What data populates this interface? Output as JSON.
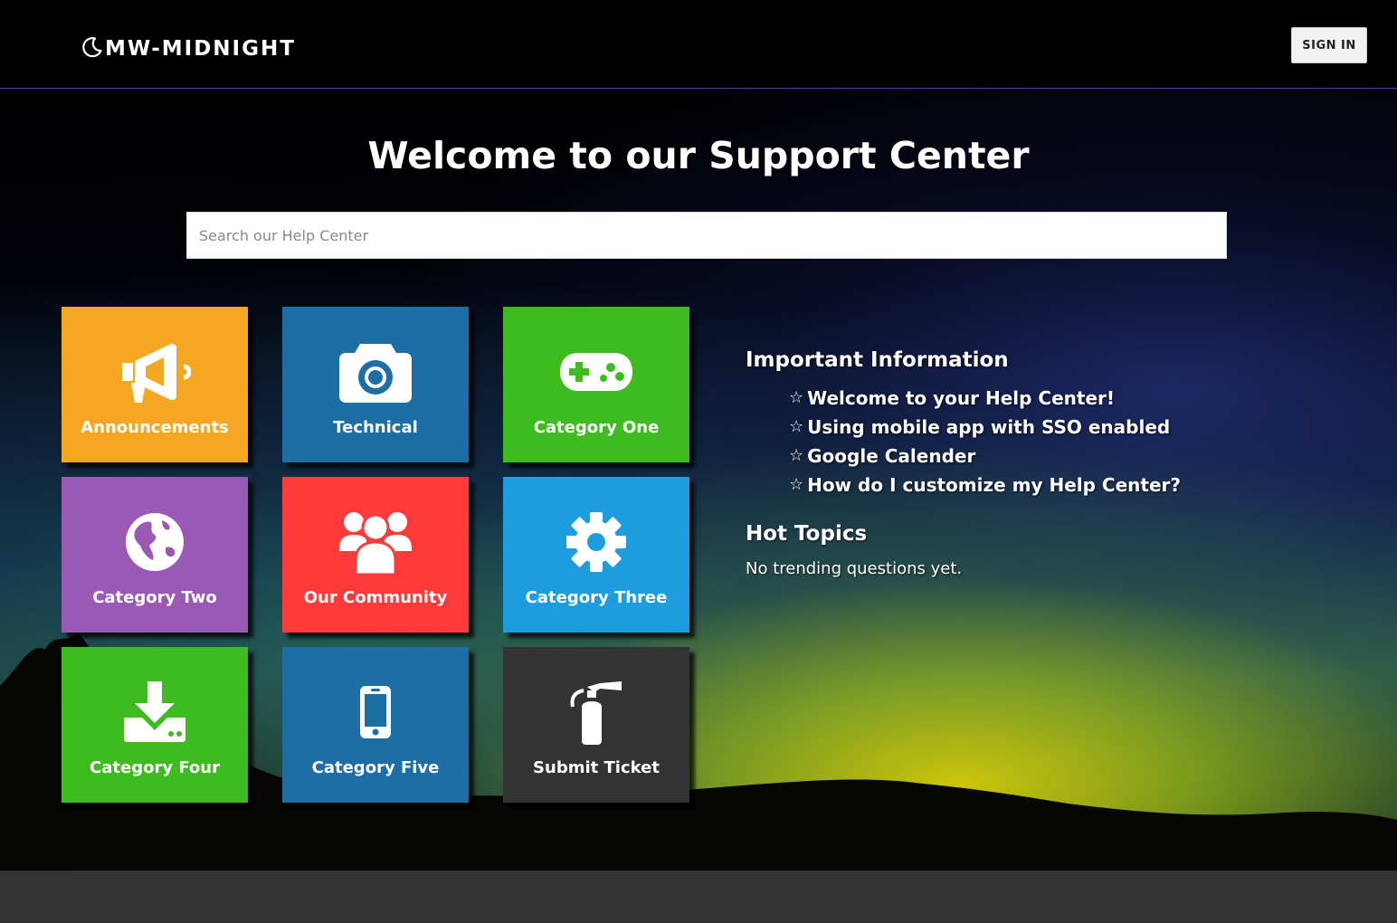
{
  "header": {
    "logo_text": "MW-MIDNIGHT",
    "logo_icon": "crescent-moon-icon",
    "signin_label": "SIGN IN"
  },
  "hero": {
    "title": "Welcome to our Support Center",
    "search_placeholder": "Search our Help Center",
    "search_value": ""
  },
  "tiles": [
    {
      "label": "Announcements",
      "icon": "megaphone-icon",
      "color": "#f5a623"
    },
    {
      "label": "Technical",
      "icon": "camera-icon",
      "color": "#1c6ea4"
    },
    {
      "label": "Category One",
      "icon": "gamepad-icon",
      "color": "#3dbb1f"
    },
    {
      "label": "Category Two",
      "icon": "globe-icon",
      "color": "#9b59b6"
    },
    {
      "label": "Our Community",
      "icon": "users-icon",
      "color": "#ff3a3a"
    },
    {
      "label": "Category Three",
      "icon": "gear-icon",
      "color": "#1d9de0"
    },
    {
      "label": "Category Four",
      "icon": "download-icon",
      "color": "#3dbb1f"
    },
    {
      "label": "Category Five",
      "icon": "mobile-phone-icon",
      "color": "#1c6ea4"
    },
    {
      "label": "Submit Ticket",
      "icon": "fire-extinguisher-icon",
      "color": "#333333"
    }
  ],
  "important": {
    "title": "Important Information",
    "star_icon": "star-outline-icon",
    "star_glyph": "☆",
    "items": [
      "Welcome to your Help Center!",
      "Using mobile app with SSO enabled",
      "Google Calender",
      "How do I customize my Help Center?"
    ]
  },
  "hot_topics": {
    "title": "Hot Topics",
    "empty_text": "No trending questions yet."
  },
  "colors": {
    "header_bg": "#000000",
    "header_border": "#3d4f9a",
    "footer_bg": "#333333",
    "signin_bg": "#f2f2f2"
  }
}
